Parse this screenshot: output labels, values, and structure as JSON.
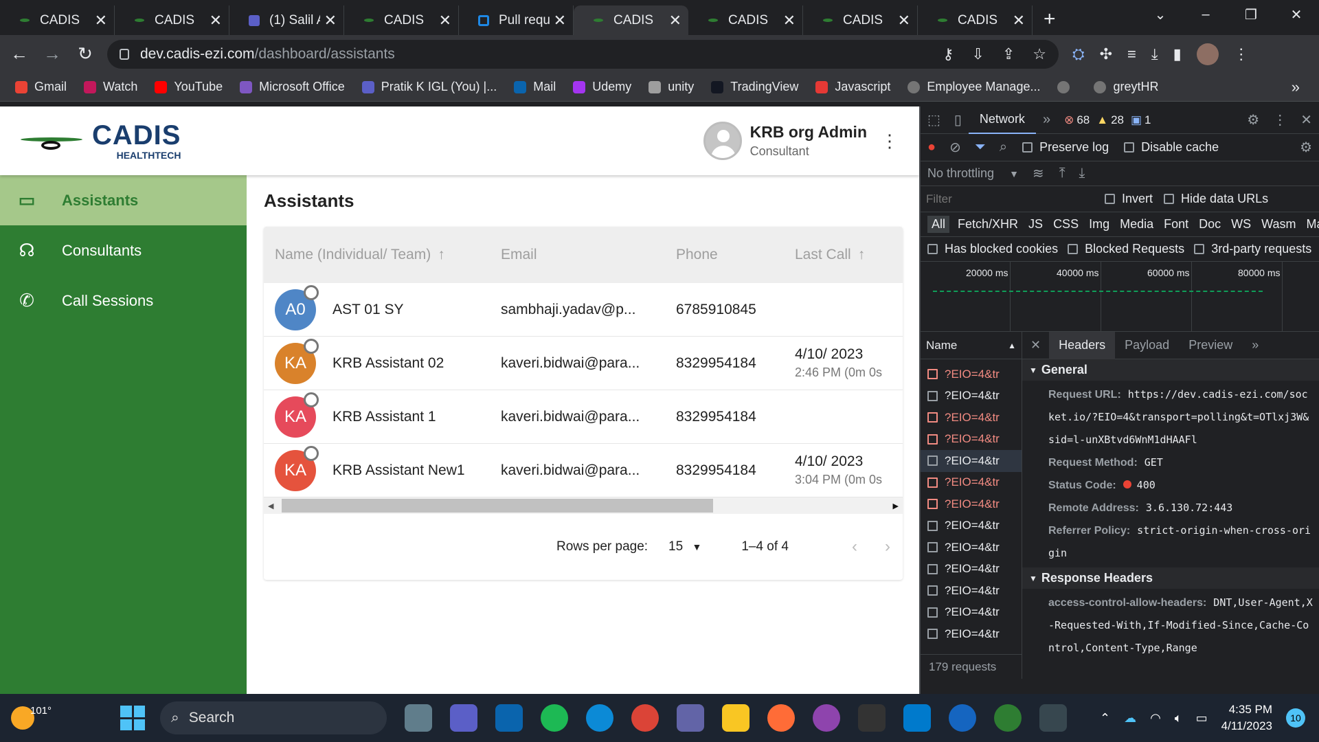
{
  "browser": {
    "tabs": [
      {
        "title": "CADIS",
        "icon": "cadis-leaf-icon"
      },
      {
        "title": "CADIS",
        "icon": "cadis-leaf-icon"
      },
      {
        "title": "(1) Salil A",
        "icon": "teams-icon"
      },
      {
        "title": "CADIS",
        "icon": "cadis-leaf-icon"
      },
      {
        "title": "Pull requ",
        "icon": "azure-devops-icon"
      },
      {
        "title": "CADIS",
        "icon": "cadis-leaf-icon",
        "active": true
      },
      {
        "title": "CADIS",
        "icon": "cadis-leaf-icon"
      },
      {
        "title": "CADIS",
        "icon": "cadis-leaf-icon"
      },
      {
        "title": "CADIS",
        "icon": "cadis-leaf-icon"
      }
    ],
    "url_host": "dev.cadis-ezi.com",
    "url_path": "/dashboard/assistants",
    "bookmarks": [
      "Gmail",
      "Watch",
      "YouTube",
      "Microsoft Office",
      "Pratik K IGL (You) |...",
      "Mail",
      "Udemy",
      "unity",
      "TradingView",
      "Javascript",
      "Employee Manage...",
      "",
      "greytHR"
    ],
    "bookmark_more": "»"
  },
  "app": {
    "logo": {
      "brand": "CADIS",
      "sub": "HEALTHTECH"
    },
    "user": {
      "name": "KRB org Admin",
      "role": "Consultant"
    },
    "nav": [
      {
        "label": "Assistants",
        "active": true,
        "icon": "assistant-icon"
      },
      {
        "label": "Consultants",
        "icon": "consultant-icon"
      },
      {
        "label": "Call Sessions",
        "icon": "phone-icon"
      }
    ],
    "page_title": "Assistants",
    "table": {
      "columns": [
        "Name (Individual/ Team)",
        "Email",
        "Phone",
        "Last Call"
      ],
      "rows": [
        {
          "initials": "A0",
          "color": "#4f86c6",
          "name": "AST 01 SY",
          "email": "sambhaji.yadav@p...",
          "phone": "6785910845",
          "last": "",
          "last2": ""
        },
        {
          "initials": "KA",
          "color": "#d9822b",
          "name": "KRB Assistant 02",
          "email": "kaveri.bidwai@para...",
          "phone": "8329954184",
          "last": "4/10/ 2023",
          "last2": "2:46 PM (0m 0s"
        },
        {
          "initials": "KA",
          "color": "#e64a5b",
          "name": "KRB Assistant 1",
          "email": "kaveri.bidwai@para...",
          "phone": "8329954184",
          "last": "",
          "last2": ""
        },
        {
          "initials": "KA",
          "color": "#e5533d",
          "name": "KRB Assistant New1",
          "email": "kaveri.bidwai@para...",
          "phone": "8329954184",
          "last": "4/10/ 2023",
          "last2": "3:04 PM (0m 0s"
        }
      ]
    },
    "pager": {
      "rows_label": "Rows per page:",
      "rows_value": "15",
      "range": "1–4 of 4"
    }
  },
  "devtools": {
    "active_tab": "Network",
    "errors": "68",
    "warnings": "28",
    "messages": "1",
    "preserve_log": "Preserve log",
    "disable_cache": "Disable cache",
    "throttling": "No throttling",
    "filter_placeholder": "Filter",
    "invert": "Invert",
    "hide_data_urls": "Hide data URLs",
    "types": [
      "All",
      "Fetch/XHR",
      "JS",
      "CSS",
      "Img",
      "Media",
      "Font",
      "Doc",
      "WS",
      "Wasm",
      "Mani"
    ],
    "has_blocked_cookies": "Has blocked cookies",
    "blocked_requests": "Blocked Requests",
    "third_party": "3rd-party requests",
    "timeline_labels": [
      "20000 ms",
      "40000 ms",
      "60000 ms",
      "80000 ms"
    ],
    "name_header": "Name",
    "requests": [
      {
        "name": "?EIO=4&tr",
        "error": true
      },
      {
        "name": "?EIO=4&tr",
        "error": false
      },
      {
        "name": "?EIO=4&tr",
        "error": true
      },
      {
        "name": "?EIO=4&tr",
        "error": true
      },
      {
        "name": "?EIO=4&tr",
        "error": false,
        "selected": true
      },
      {
        "name": "?EIO=4&tr",
        "error": true
      },
      {
        "name": "?EIO=4&tr",
        "error": true
      },
      {
        "name": "?EIO=4&tr",
        "error": false
      },
      {
        "name": "?EIO=4&tr",
        "error": false
      },
      {
        "name": "?EIO=4&tr",
        "error": false
      },
      {
        "name": "?EIO=4&tr",
        "error": false
      },
      {
        "name": "?EIO=4&tr",
        "error": false
      },
      {
        "name": "?EIO=4&tr",
        "error": false
      }
    ],
    "request_count": "179 requests",
    "detail_tabs": [
      "Headers",
      "Payload",
      "Preview"
    ],
    "general_title": "General",
    "general": [
      {
        "k": "Request URL:",
        "v": "https://dev.cadis-ezi.com/socket.io/?EIO=4&transport=polling&t=OTlxj3W&sid=l-unXBtvd6WnM1dHAAFl"
      },
      {
        "k": "Request Method:",
        "v": "GET"
      },
      {
        "k": "Status Code:",
        "v": "400"
      },
      {
        "k": "Remote Address:",
        "v": "3.6.130.72:443"
      },
      {
        "k": "Referrer Policy:",
        "v": "strict-origin-when-cross-origin"
      }
    ],
    "response_title": "Response Headers",
    "response": [
      {
        "k": "access-control-allow-headers:",
        "v": "DNT,User-Agent,X-Requested-With,If-Modified-Since,Cache-Control,Content-Type,Range"
      }
    ]
  },
  "taskbar": {
    "temp": "101°",
    "search": "Search",
    "time": "4:35 PM",
    "date": "4/11/2023",
    "notifications": "10"
  }
}
